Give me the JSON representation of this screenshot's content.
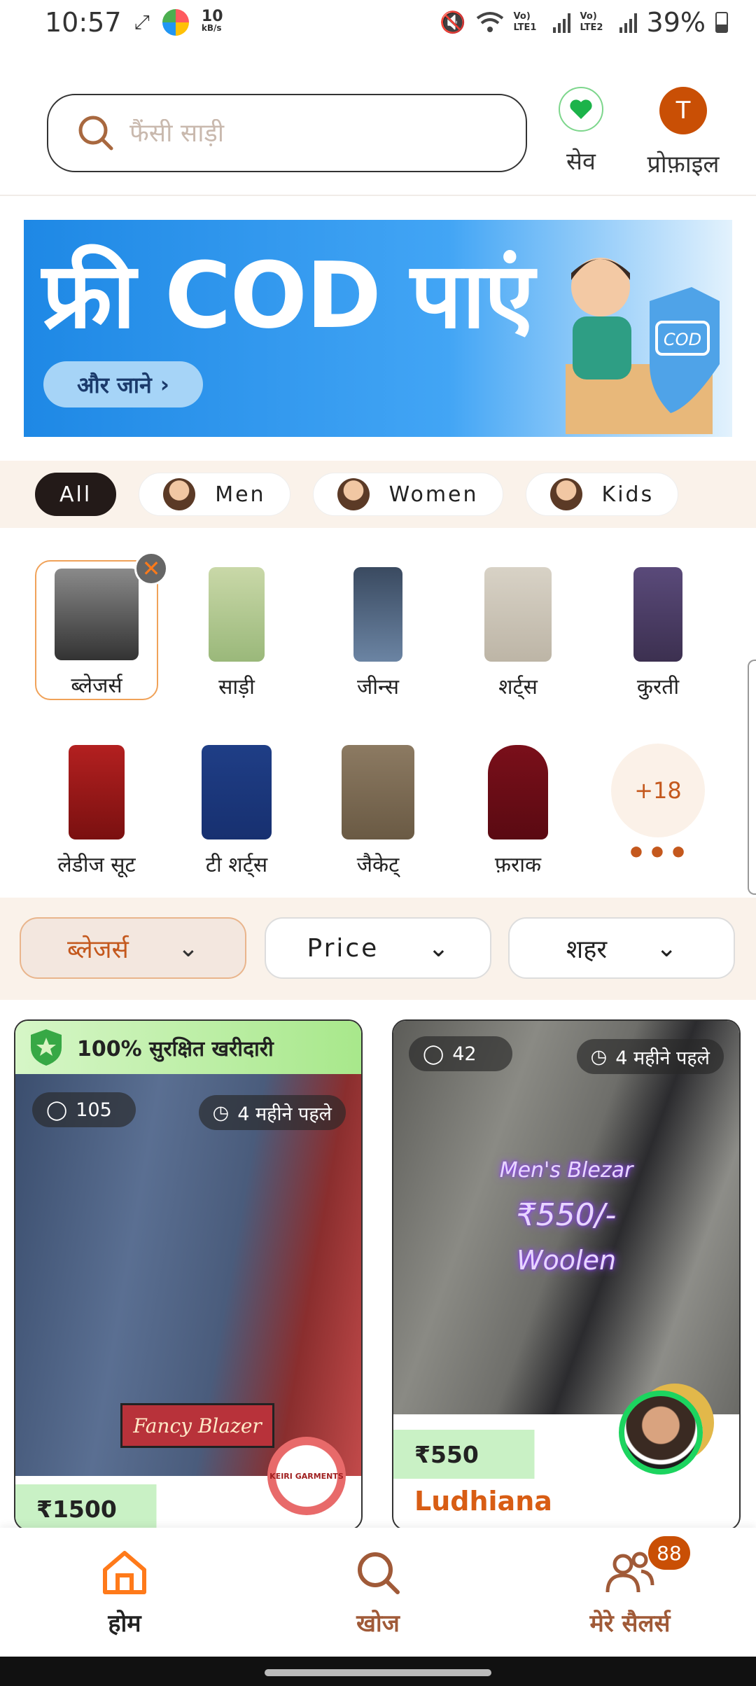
{
  "status_bar": {
    "time": "10:57",
    "net_speed_value": "10",
    "net_speed_unit": "kB/s",
    "sim1": "Vo) LTE1",
    "sim2": "Vo) LTE2",
    "battery": "39%"
  },
  "header": {
    "search_placeholder": "फैंसी साड़ी",
    "save_label": "सेव",
    "profile_label": "प्रोफ़ाइल",
    "profile_initial": "T"
  },
  "banner": {
    "title": "फ्री COD पाएं",
    "button_label": "और जाने",
    "cod_text": "COD"
  },
  "gender_chips": [
    {
      "label": "All",
      "active": true
    },
    {
      "label": "Men",
      "active": false
    },
    {
      "label": "Women",
      "active": false
    },
    {
      "label": "Kids",
      "active": false
    }
  ],
  "categories": [
    {
      "label": "ब्लेजर्स",
      "selected": true
    },
    {
      "label": "साड़ी"
    },
    {
      "label": "जीन्स"
    },
    {
      "label": "शर्ट्स"
    },
    {
      "label": "कुरती"
    },
    {
      "label": "लेडीज सूट"
    },
    {
      "label": "टी शर्ट्स"
    },
    {
      "label": "जैकेट्"
    },
    {
      "label": "फ़राक"
    }
  ],
  "more_categories": {
    "count": "+18",
    "dots": "•••"
  },
  "filters": [
    {
      "label": "ब्लेजर्स",
      "active": true
    },
    {
      "label": "Price",
      "active": false
    },
    {
      "label": "शहर",
      "active": false
    }
  ],
  "products": [
    {
      "safe_badge": "100% सुरक्षित खरीदारी",
      "whatsapp_count": "105",
      "time_ago": "4 महीने पहले",
      "overlay_title": "Fancy Blazer",
      "price": "₹1500",
      "seller_logo_text": "KEIRI GARMENTS"
    },
    {
      "whatsapp_count": "42",
      "time_ago": "4 महीने पहले",
      "overlay_line1": "Men's Blezar",
      "overlay_line2": "₹550/-",
      "overlay_line3": "Woolen",
      "price": "₹550",
      "city": "Ludhiana"
    }
  ],
  "bottom_nav": [
    {
      "label": "होम",
      "active": true
    },
    {
      "label": "खोज",
      "active": false
    },
    {
      "label": "मेरे सैलर्स",
      "active": false,
      "badge": "88"
    }
  ],
  "colors": {
    "accent": "#c94f05",
    "chip_active": "#231a18",
    "section_bg": "#faf2ea",
    "price_tag": "#c9f1c5"
  }
}
